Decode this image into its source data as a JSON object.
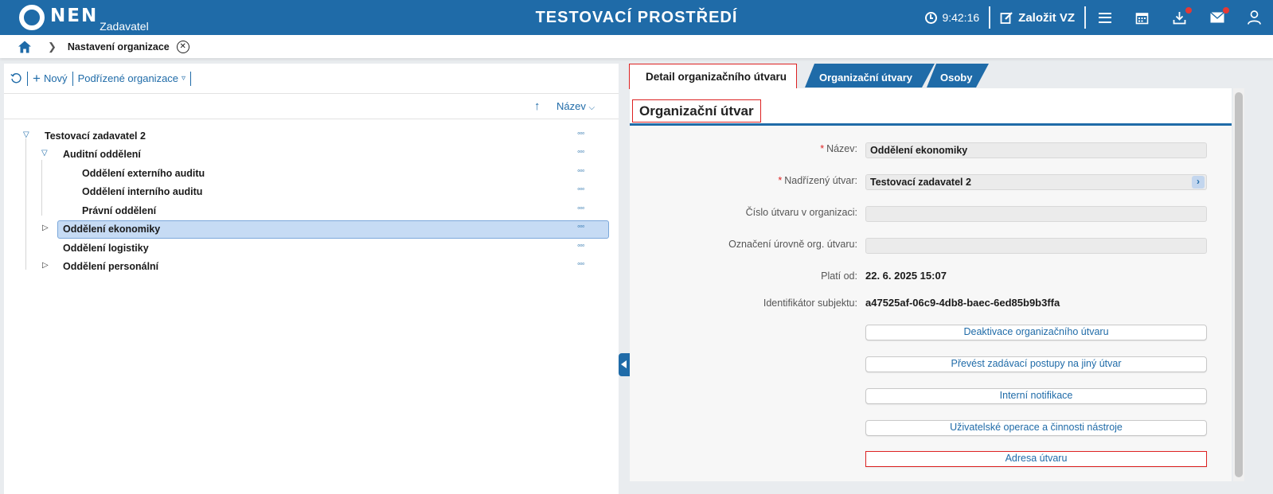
{
  "header": {
    "logo_text": "NEN",
    "logo_sub": "Zadavatel",
    "env_title": "TESTOVACÍ PROSTŘEDÍ",
    "time": "9:42:16",
    "create_label": "Založit VZ"
  },
  "breadcrumb": {
    "current": "Nastavení organizace"
  },
  "left": {
    "toolbar": {
      "new_label": "Nový",
      "sub_orgs_label": "Podřízené organizace"
    },
    "sort_label": "Název",
    "tree": [
      {
        "label": "Testovací zadavatel 2",
        "level": 0,
        "expanded": true
      },
      {
        "label": "Auditní oddělení",
        "level": 1,
        "expanded": true
      },
      {
        "label": "Oddělení externího auditu",
        "level": 2
      },
      {
        "label": "Oddělení interního auditu",
        "level": 2
      },
      {
        "label": "Právní oddělení",
        "level": 2
      },
      {
        "label": "Oddělení ekonomiky",
        "level": 1,
        "expanded": false,
        "selected": true
      },
      {
        "label": "Oddělení logistiky",
        "level": 1
      },
      {
        "label": "Oddělení personální",
        "level": 1,
        "expanded": false
      }
    ]
  },
  "right": {
    "tabs": {
      "detail": "Detail organizačního útvaru",
      "units": "Organizační útvary",
      "persons": "Osoby"
    },
    "section_title": "Organizační útvar",
    "fields": {
      "name_label": "Název",
      "name_value": "Oddělení ekonomiky",
      "parent_label": "Nadřízený útvar",
      "parent_value": "Testovací zadavatel 2",
      "number_label": "Číslo útvaru v organizaci",
      "number_value": "",
      "level_label": "Označení úrovně org. útvaru",
      "level_value": "",
      "valid_from_label": "Platí od",
      "valid_from_value": "22. 6. 2025 15:07",
      "subject_id_label": "Identifikátor subjektu",
      "subject_id_value": "a47525af-06c9-4db8-baec-6ed85b9b3ffa"
    },
    "buttons": {
      "deactivate": "Deaktivace organizačního útvaru",
      "transfer": "Převést zadávací postupy na jiný útvar",
      "notifications": "Interní notifikace",
      "user_ops": "Uživatelské operace a činnosti nástroje",
      "address": "Adresa útvaru"
    }
  }
}
